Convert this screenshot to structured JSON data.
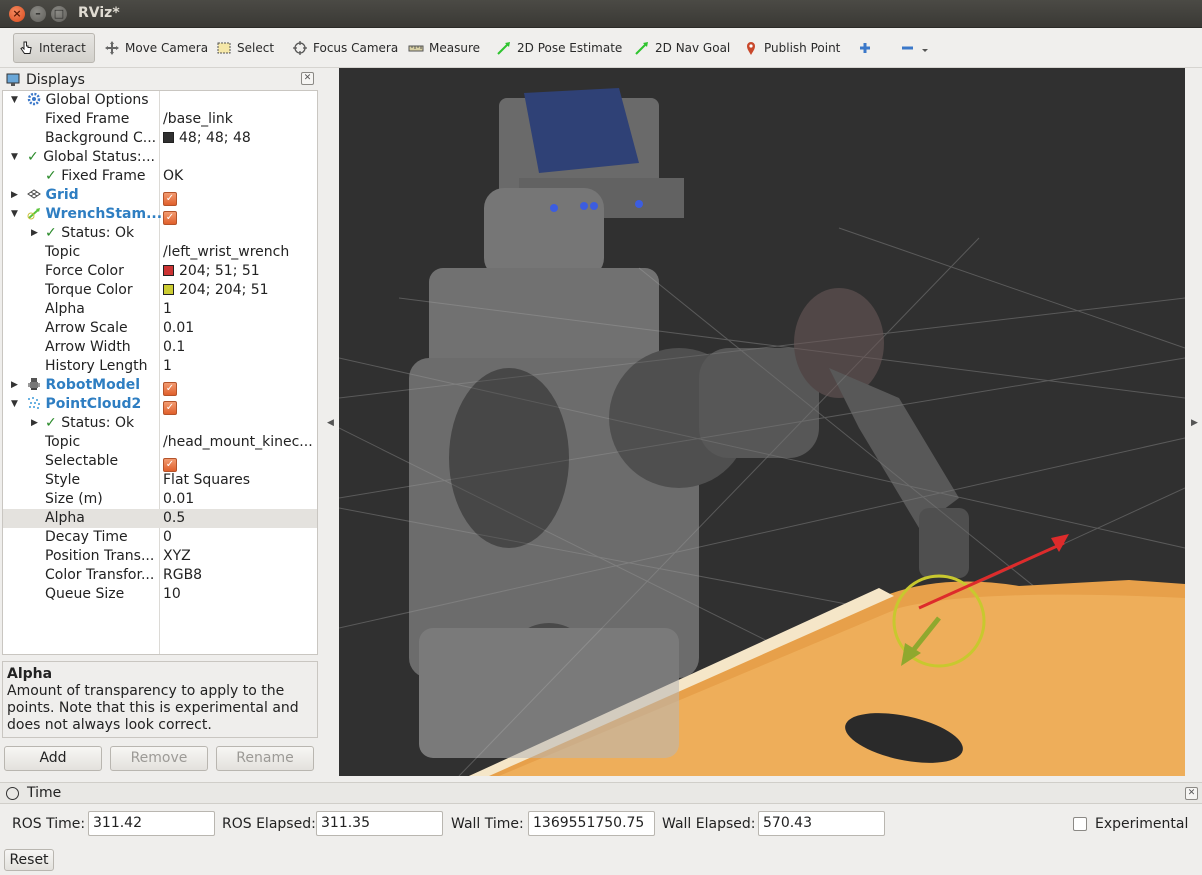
{
  "window": {
    "title": "RViz*"
  },
  "toolbar": {
    "interact": "Interact",
    "move_camera": "Move Camera",
    "select": "Select",
    "focus_camera": "Focus Camera",
    "measure": "Measure",
    "pose_estimate": "2D Pose Estimate",
    "nav_goal": "2D Nav Goal",
    "publish_point": "Publish Point"
  },
  "displays": {
    "title": "Displays",
    "rows": [
      {
        "label": "Global Options",
        "value": ""
      },
      {
        "label": "Fixed Frame",
        "value": "/base_link"
      },
      {
        "label": "Background C...",
        "value": "48; 48; 48",
        "color": "#303030"
      },
      {
        "label": "Global Status:...",
        "value": ""
      },
      {
        "label": "Fixed Frame",
        "value": "OK"
      },
      {
        "label": "Grid",
        "value": ""
      },
      {
        "label": "WrenchStam...",
        "value": ""
      },
      {
        "label": "Status: Ok",
        "value": ""
      },
      {
        "label": "Topic",
        "value": "/left_wrist_wrench"
      },
      {
        "label": "Force Color",
        "value": "204; 51; 51",
        "color": "#cc3333"
      },
      {
        "label": "Torque Color",
        "value": "204; 204; 51",
        "color": "#cccc33"
      },
      {
        "label": "Alpha",
        "value": "1"
      },
      {
        "label": "Arrow Scale",
        "value": "0.01"
      },
      {
        "label": "Arrow Width",
        "value": "0.1"
      },
      {
        "label": "History Length",
        "value": "1"
      },
      {
        "label": "RobotModel",
        "value": ""
      },
      {
        "label": "PointCloud2",
        "value": ""
      },
      {
        "label": "Status: Ok",
        "value": ""
      },
      {
        "label": "Topic",
        "value": "/head_mount_kinec..."
      },
      {
        "label": "Selectable",
        "value": ""
      },
      {
        "label": "Style",
        "value": "Flat Squares"
      },
      {
        "label": "Size (m)",
        "value": "0.01"
      },
      {
        "label": "Alpha",
        "value": "0.5"
      },
      {
        "label": "Decay Time",
        "value": "0"
      },
      {
        "label": "Position Trans...",
        "value": "XYZ"
      },
      {
        "label": "Color Transfor...",
        "value": "RGB8"
      },
      {
        "label": "Queue Size",
        "value": "10"
      }
    ],
    "description": {
      "title": "Alpha",
      "text": "Amount of transparency to apply to the points. Note that this is experimental and does not always look correct."
    },
    "buttons": {
      "add": "Add",
      "remove": "Remove",
      "rename": "Rename"
    }
  },
  "time": {
    "title": "Time",
    "ros_time_label": "ROS Time:",
    "ros_time": "311.42",
    "ros_elapsed_label": "ROS Elapsed:",
    "ros_elapsed": "311.35",
    "wall_time_label": "Wall Time:",
    "wall_time": "1369551750.75",
    "wall_elapsed_label": "Wall Elapsed:",
    "wall_elapsed": "570.43",
    "experimental_label": "Experimental",
    "reset_label": "Reset"
  }
}
